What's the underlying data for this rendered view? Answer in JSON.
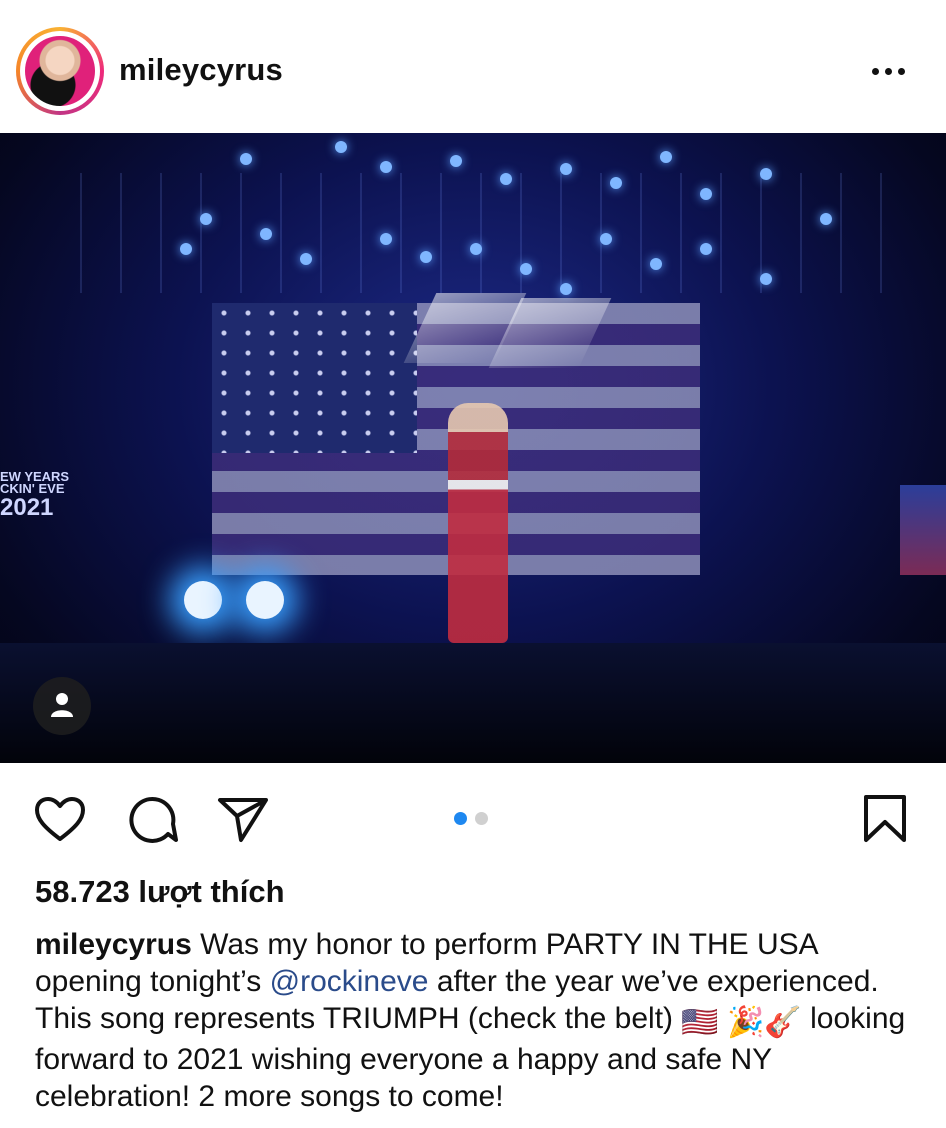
{
  "post": {
    "username": "mileycyrus",
    "more_icon": "more-horizontal-icon",
    "likes_text": "58.723 lượt thích",
    "caption": {
      "username": "mileycyrus",
      "text_part1": " Was my honor to perform PARTY IN THE USA opening tonight’s ",
      "mention": "@rockineve",
      "text_part2": " after the year we’ve experienced. This song represents TRIUMPH (check the belt) ",
      "emojis": [
        "🇺🇸",
        "🎉",
        "🎸"
      ],
      "text_part3": " looking forward to 2021 wishing everyone a happy and safe NY celebration! 2 more songs to come!"
    },
    "carousel": {
      "count": 2,
      "active_index": 0
    }
  },
  "photo": {
    "sign_line1": "EW YEARS",
    "sign_line2": "CKIN' EVE",
    "sign_year": "2021"
  },
  "colors": {
    "accent_blue": "#1e88f0",
    "mention": "#2a4b8a"
  },
  "icons": {
    "like": "heart-icon",
    "comment": "comment-icon",
    "share": "send-icon",
    "save": "bookmark-icon",
    "tag": "person-icon"
  }
}
